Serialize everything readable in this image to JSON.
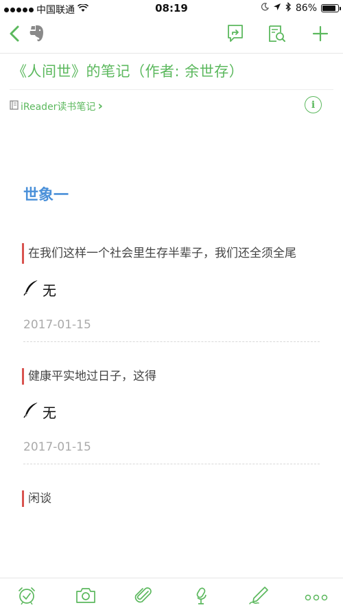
{
  "status_bar": {
    "carrier": "中国联通",
    "time": "08:19",
    "battery_percent": "86%",
    "battery_level": 0.86,
    "signal_bars": 5,
    "icons": [
      "signal-dots-icon",
      "wifi-icon",
      "moon-icon",
      "location-arrow-icon",
      "bluetooth-icon",
      "battery-icon"
    ]
  },
  "navbar": {
    "icons": [
      "back-chevron-icon",
      "evernote-elephant-icon",
      "share-icon",
      "search-in-note-icon",
      "add-icon"
    ]
  },
  "note": {
    "title": "《人间世》的笔记（作者: 余世存）",
    "source_label": "iReader读书笔记",
    "source_chevron": "›",
    "info_glyph": "i"
  },
  "content": {
    "heading": "世象一",
    "entries": [
      {
        "quote": "在我们这样一个社会里生存半辈子，我们还全须全尾",
        "comment": "无",
        "date": "2017-01-15"
      },
      {
        "quote": "健康平实地过日子，这得",
        "comment": "无",
        "date": "2017-01-15"
      },
      {
        "quote": "闲谈"
      }
    ]
  },
  "toolbar": {
    "icons": [
      "reminder-alarm-icon",
      "camera-icon",
      "attachment-paperclip-icon",
      "microphone-icon",
      "handwriting-pen-icon",
      "more-icon"
    ]
  },
  "colors": {
    "accent_green": "#5bb85d",
    "heading_blue": "#4a90d9",
    "quote_bar_red": "#d9534f",
    "date_gray": "#aaaaaa"
  }
}
